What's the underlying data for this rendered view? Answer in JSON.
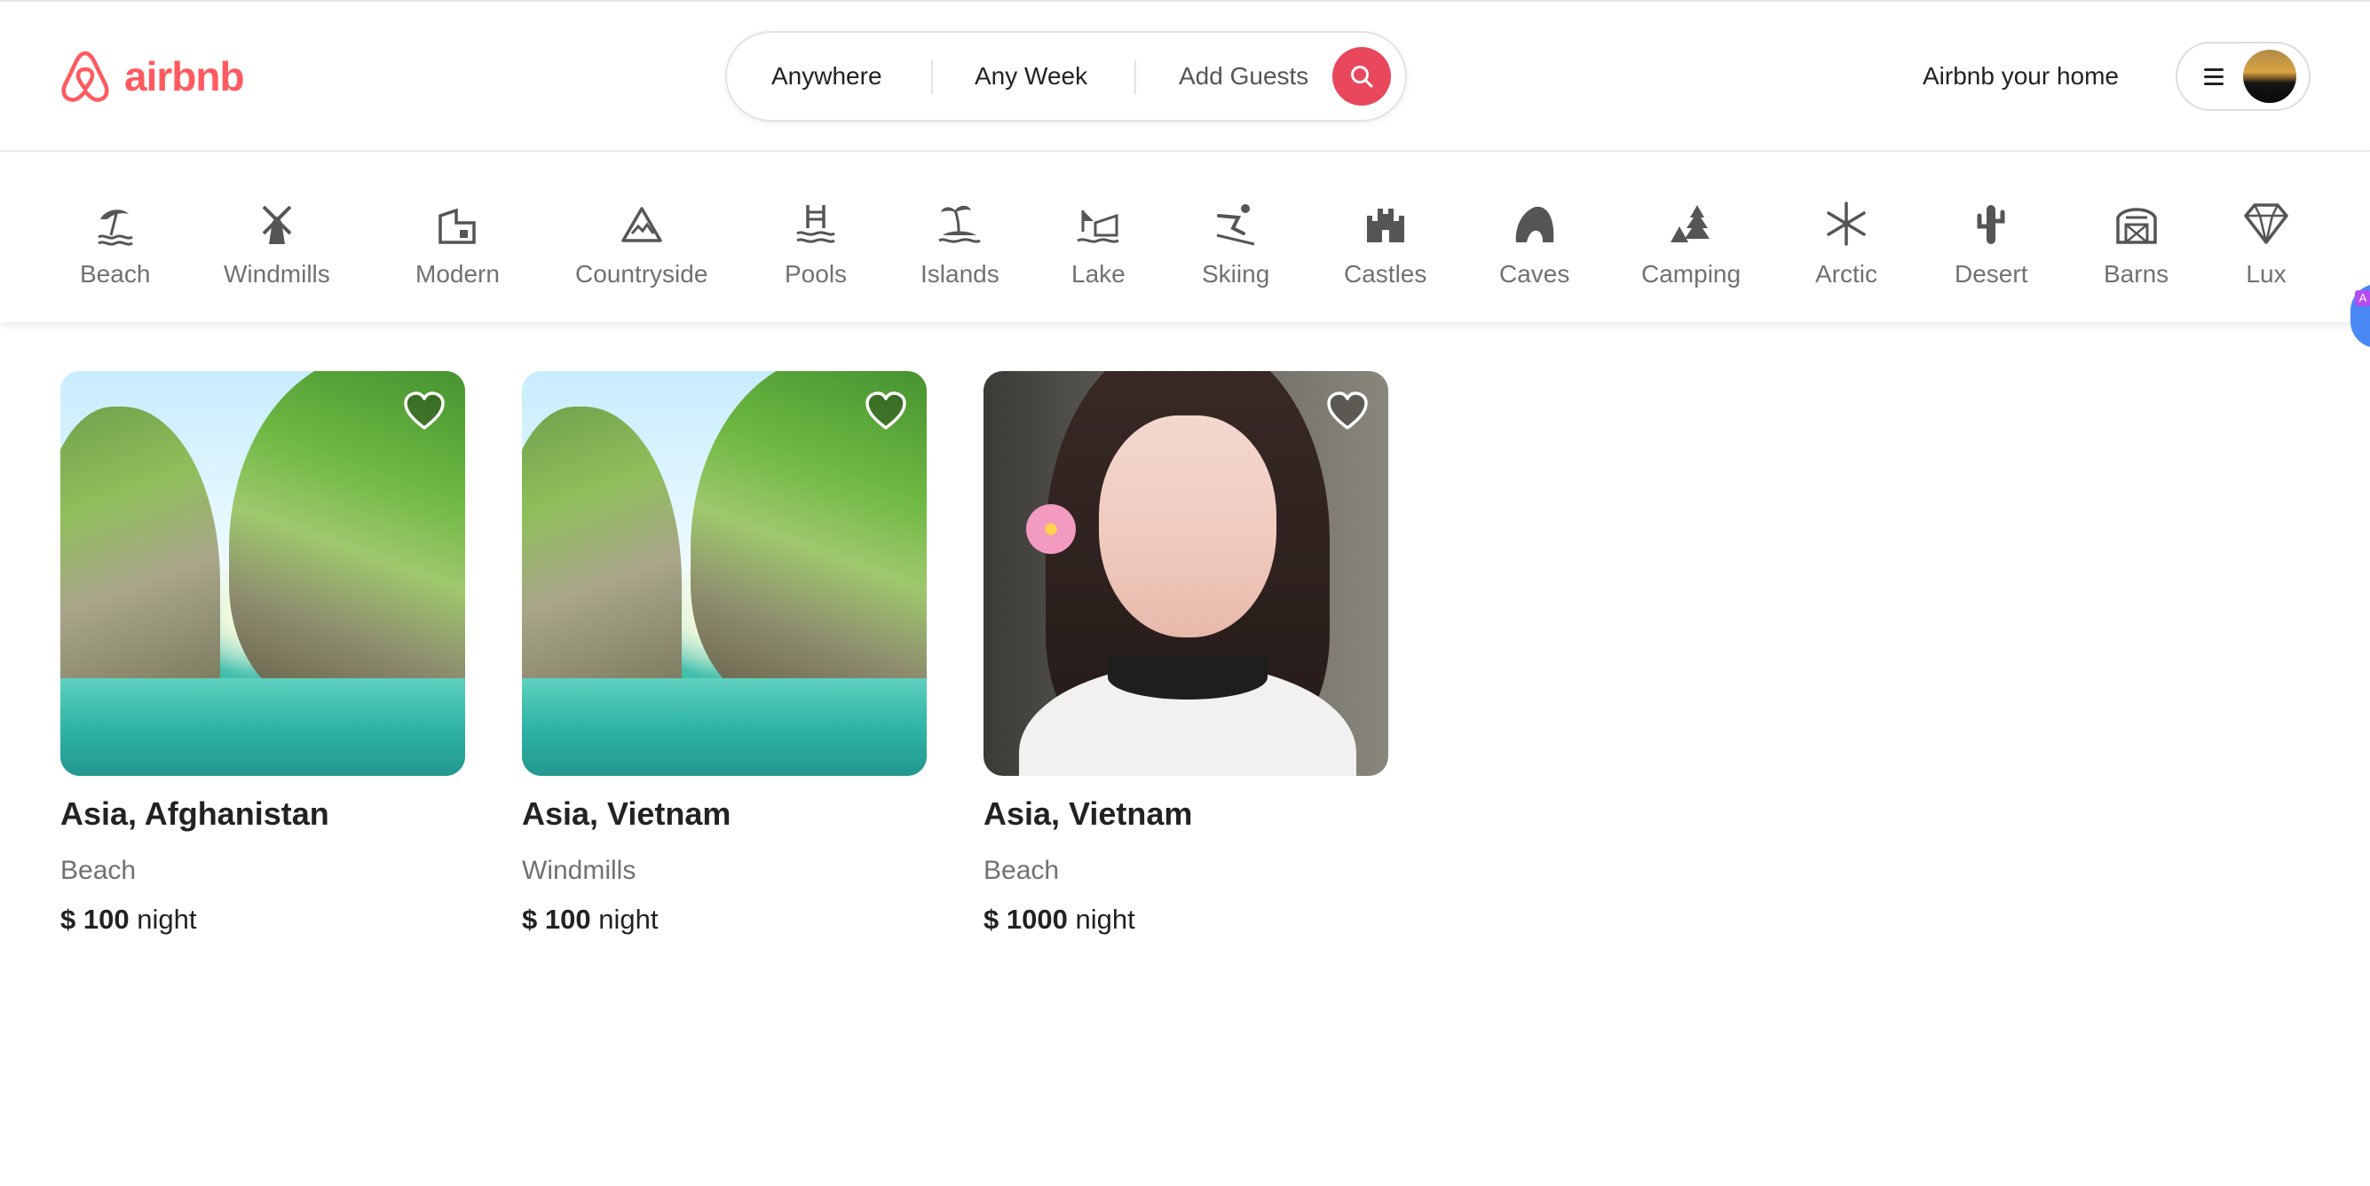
{
  "brand": {
    "name": "airbnb",
    "color": "#ff5a5f"
  },
  "search": {
    "location": "Anywhere",
    "dates": "Any Week",
    "guests": "Add Guests",
    "button_color": "#e8475c"
  },
  "header": {
    "host_link": "Airbnb your home"
  },
  "categories": [
    {
      "label": "Beach",
      "icon": "beach-icon"
    },
    {
      "label": "Windmills",
      "icon": "windmill-icon"
    },
    {
      "label": "Modern",
      "icon": "modern-house-icon"
    },
    {
      "label": "Countryside",
      "icon": "mountain-icon"
    },
    {
      "label": "Pools",
      "icon": "pool-icon"
    },
    {
      "label": "Islands",
      "icon": "island-icon"
    },
    {
      "label": "Lake",
      "icon": "lake-icon"
    },
    {
      "label": "Skiing",
      "icon": "skier-icon"
    },
    {
      "label": "Castles",
      "icon": "castle-icon"
    },
    {
      "label": "Caves",
      "icon": "cave-icon"
    },
    {
      "label": "Camping",
      "icon": "tent-icon"
    },
    {
      "label": "Arctic",
      "icon": "snowflake-icon"
    },
    {
      "label": "Desert",
      "icon": "cactus-icon"
    },
    {
      "label": "Barns",
      "icon": "barn-icon"
    },
    {
      "label": "Lux",
      "icon": "diamond-icon"
    }
  ],
  "listings": [
    {
      "title": "Asia, Afghanistan",
      "category": "Beach",
      "currency": "$",
      "price": "100",
      "unit": "night",
      "image": "tropical-cliffs"
    },
    {
      "title": "Asia, Vietnam",
      "category": "Windmills",
      "currency": "$",
      "price": "100",
      "unit": "night",
      "image": "tropical-cliffs"
    },
    {
      "title": "Asia, Vietnam",
      "category": "Beach",
      "currency": "$",
      "price": "1000",
      "unit": "night",
      "image": "portrait"
    }
  ]
}
